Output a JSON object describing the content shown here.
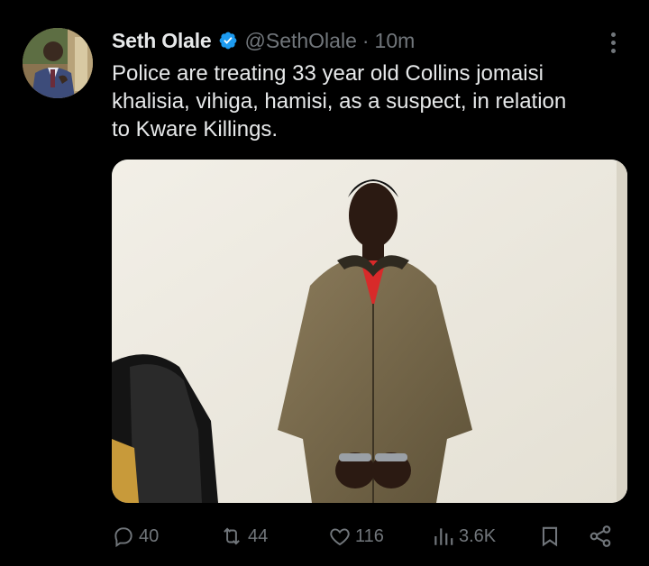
{
  "tweet": {
    "author_name": "Seth Olale",
    "handle": "@SethOlale",
    "separator": "·",
    "time": "10m",
    "text_lines": [
      "Police are treating 33 year old Collins jomaisi",
      "khalisia, vihiga, hamisi, as a suspect, in relation",
      "to Kware Killings."
    ],
    "verified": true
  },
  "actions": {
    "replies": "40",
    "reposts": "44",
    "likes": "116",
    "views": "3.6K"
  },
  "icons": {
    "verified": "verified-badge-icon",
    "more": "more-options-icon",
    "reply": "reply-icon",
    "repost": "repost-icon",
    "like": "heart-icon",
    "views": "views-chart-icon",
    "bookmark": "bookmark-icon",
    "share": "share-icon"
  },
  "colors": {
    "background": "#000000",
    "text": "#e7e9ea",
    "muted": "#71767b",
    "verified": "#1d9bf0"
  }
}
